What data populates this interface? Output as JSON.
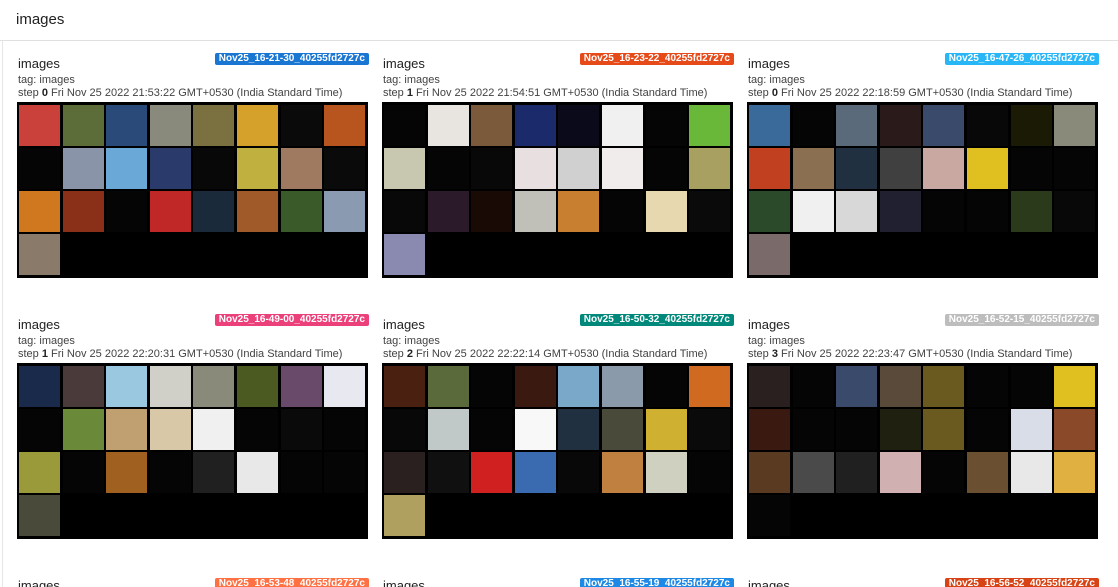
{
  "section": {
    "title": "images"
  },
  "cards": [
    {
      "title": "images",
      "run": "Nov25_16-21-30_40255fd2727c",
      "run_color": "#1976d2",
      "tag": "tag: images",
      "step_label": "step",
      "step": "0",
      "time": "Fri Nov 25 2022 21:53:22 GMT+0530 (India Standard Time)",
      "thumbs": [
        "#c9413a",
        "#5c6d3a",
        "#2a4a7a",
        "#8a8a7c",
        "#7a7040",
        "#d6a12a",
        "#0a0a0a",
        "#b8541e",
        "#050505",
        "#8a94a8",
        "#6aa8d8",
        "#2a3a6a",
        "#080808",
        "#c0b040",
        "#a07a60",
        "#0a0a0a",
        "#d07820",
        "#8a3018",
        "#050505",
        "#c02828",
        "#1a2a3a",
        "#a05a2a",
        "#3a5a2a",
        "#8a9ab0",
        "#8a7a6a"
      ]
    },
    {
      "title": "images",
      "run": "Nov25_16-23-22_40255fd2727c",
      "run_color": "#e64a19",
      "tag": "tag: images",
      "step_label": "step",
      "step": "1",
      "time": "Fri Nov 25 2022 21:54:51 GMT+0530 (India Standard Time)",
      "thumbs": [
        "#050505",
        "#e8e4e0",
        "#7a5a3a",
        "#1a2a6a",
        "#0a0a1a",
        "#f0f0f0",
        "#050505",
        "#6ab83a",
        "#c8c8b0",
        "#050505",
        "#080808",
        "#e8e0e0",
        "#d0d0d0",
        "#f0ecec",
        "#050505",
        "#a8a060",
        "#080808",
        "#2a1a2a",
        "#1a0a05",
        "#c0c0b8",
        "#c88030",
        "#050505",
        "#e8d8b0",
        "#0a0a0a",
        "#8a8ab0"
      ]
    },
    {
      "title": "images",
      "run": "Nov25_16-47-26_40255fd2727c",
      "run_color": "#29b6f6",
      "tag": "tag: images",
      "step_label": "step",
      "step": "0",
      "time": "Fri Nov 25 2022 22:18:59 GMT+0530 (India Standard Time)",
      "thumbs": [
        "#3a6a9a",
        "#050505",
        "#5a6a7a",
        "#2a1a1a",
        "#3a4a6a",
        "#080808",
        "#1a1a05",
        "#8a8a7a",
        "#c04020",
        "#8a7050",
        "#203040",
        "#404040",
        "#c8a8a0",
        "#e0c020",
        "#050505",
        "#050505",
        "#2a4a2a",
        "#f0f0f0",
        "#d8d8d8",
        "#202030",
        "#050505",
        "#050505",
        "#2a3a1a",
        "#080808",
        "#7a6a6a"
      ]
    },
    {
      "title": "images",
      "run": "Nov25_16-49-00_40255fd2727c",
      "run_color": "#ec407a",
      "tag": "tag: images",
      "step_label": "step",
      "step": "1",
      "time": "Fri Nov 25 2022 22:20:31 GMT+0530 (India Standard Time)",
      "thumbs": [
        "#1a2a4a",
        "#4a3a3a",
        "#9ac8e0",
        "#d0d0c8",
        "#8a8a7a",
        "#4a5a20",
        "#6a4a6a",
        "#e8e8f0",
        "#050505",
        "#6a8a3a",
        "#c0a070",
        "#d8c8a8",
        "#f0f0f0",
        "#050505",
        "#0a0a0a",
        "#050505",
        "#9a9a3a",
        "#050505",
        "#a06020",
        "#050505",
        "#202020",
        "#e8e8e8",
        "#050505",
        "#050505",
        "#4a4a3a"
      ]
    },
    {
      "title": "images",
      "run": "Nov25_16-50-32_40255fd2727c",
      "run_color": "#00897b",
      "tag": "tag: images",
      "step_label": "step",
      "step": "2",
      "time": "Fri Nov 25 2022 22:22:14 GMT+0530 (India Standard Time)",
      "thumbs": [
        "#4a2010",
        "#5a6a3a",
        "#050505",
        "#3a1a10",
        "#7aa8c8",
        "#8a9aaa",
        "#050505",
        "#d06a20",
        "#080808",
        "#c0c8c8",
        "#050505",
        "#f8f8f8",
        "#203040",
        "#4a4a3a",
        "#d0b030",
        "#0a0a0a",
        "#2a2020",
        "#101010",
        "#d02020",
        "#3a6ab0",
        "#080808",
        "#c08040",
        "#d0d0c0",
        "#050505",
        "#b0a060"
      ]
    },
    {
      "title": "images",
      "run": "Nov25_16-52-15_40255fd2727c",
      "run_color": "#bdbdbd",
      "tag": "tag: images",
      "step_label": "step",
      "step": "3",
      "time": "Fri Nov 25 2022 22:23:47 GMT+0530 (India Standard Time)",
      "thumbs": [
        "#2a2020",
        "#050505",
        "#3a4a6a",
        "#5a4a3a",
        "#6a5a20",
        "#050505",
        "#050505",
        "#e0c020",
        "#3a1a10",
        "#050505",
        "#050505",
        "#202010",
        "#6a5a20",
        "#050505",
        "#d8dde8",
        "#8a4a2a",
        "#5a3a20",
        "#4a4a4a",
        "#202020",
        "#d0b0b0",
        "#050505",
        "#6a5030",
        "#e8e8e8",
        "#e0b040",
        "#050505"
      ]
    }
  ],
  "partial_cards": [
    {
      "title": "images",
      "run": "Nov25_16-53-48_40255fd2727c",
      "run_color": "#ff7043"
    },
    {
      "title": "images",
      "run": "Nov25_16-55-19_40255fd2727c",
      "run_color": "#1e88e5"
    },
    {
      "title": "images",
      "run": "Nov25_16-56-52_40255fd2727c",
      "run_color": "#d84315"
    }
  ]
}
